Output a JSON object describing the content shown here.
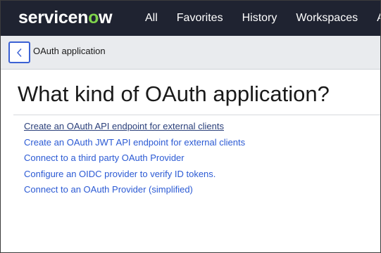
{
  "navbar": {
    "logo_text_before": "servicen",
    "logo_text_o": "o",
    "logo_text_after": "w",
    "items": [
      {
        "label": "All"
      },
      {
        "label": "Favorites"
      },
      {
        "label": "History"
      },
      {
        "label": "Workspaces"
      },
      {
        "label": "A"
      }
    ]
  },
  "header": {
    "title": "OAuth application",
    "back_icon": "chevron-left-icon"
  },
  "main": {
    "title": "What kind of OAuth application?",
    "links": [
      {
        "label": "Create an OAuth API endpoint for external clients"
      },
      {
        "label": "Create an OAuth JWT API endpoint for external clients"
      },
      {
        "label": "Connect to a third party OAuth Provider"
      },
      {
        "label": "Configure an OIDC provider to verify ID tokens."
      },
      {
        "label": "Connect to an OAuth Provider (simplified)"
      }
    ]
  },
  "colors": {
    "navbar_bg": "#1f2331",
    "logo_accent": "#7fd34c",
    "link": "#2b5ad4",
    "link_visited": "#2a3f7a",
    "focus_border": "#3b61d4",
    "subheader_bg": "#e9ebee"
  }
}
